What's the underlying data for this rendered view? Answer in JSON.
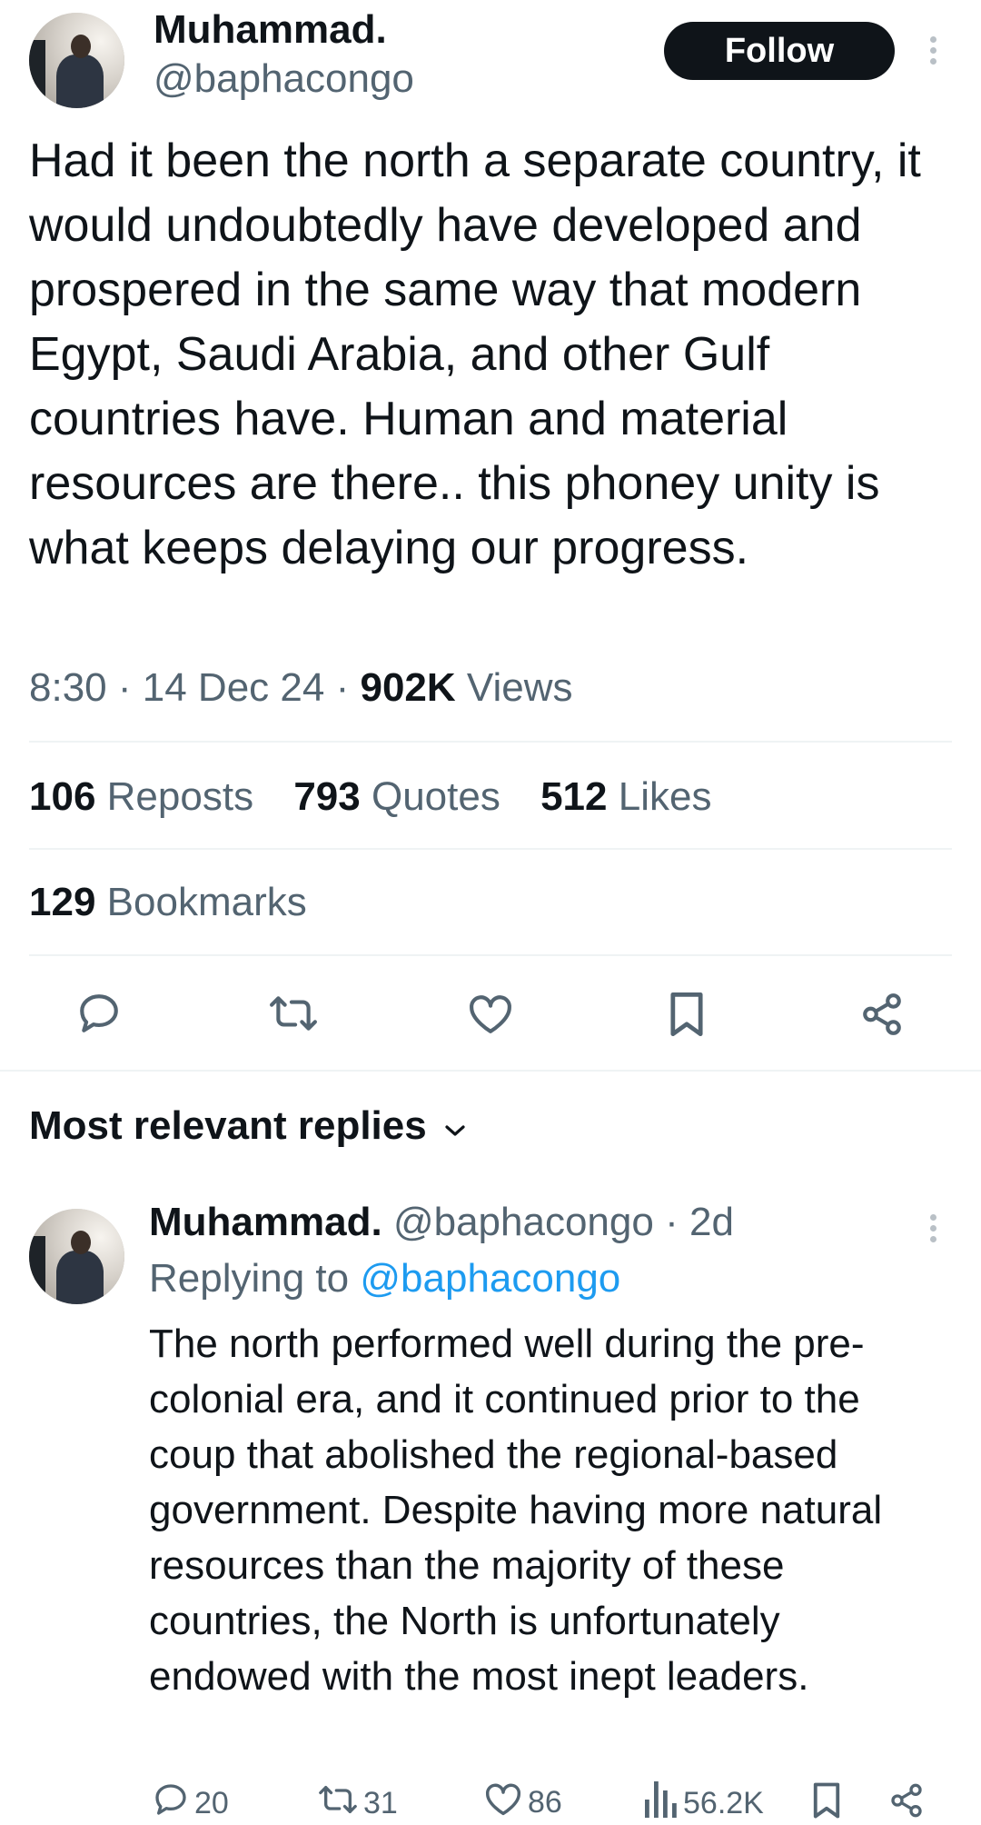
{
  "tweet": {
    "author_name": "Muhammad.",
    "author_handle": "@baphacongo",
    "follow_label": "Follow",
    "text": "Had it been the north a separate country, it would undoubtedly have developed and prospered in the same way that modern Egypt, Saudi Arabia, and other Gulf countries have. Human and material resources are there.. this phoney unity is what keeps delaying our progress.",
    "time": "8:30",
    "date": "14 Dec 24",
    "separator": "·",
    "views_count": "902K",
    "views_label": "Views"
  },
  "stats": {
    "reposts_count": "106",
    "reposts_label": "Reposts",
    "quotes_count": "793",
    "quotes_label": "Quotes",
    "likes_count": "512",
    "likes_label": "Likes",
    "bookmarks_count": "129",
    "bookmarks_label": "Bookmarks"
  },
  "actions": [
    "reply-icon",
    "repost-icon",
    "like-icon",
    "bookmark-icon",
    "share-icon"
  ],
  "replies_header": {
    "label": "Most relevant replies"
  },
  "reply": {
    "author_name": "Muhammad.",
    "author_handle": "@baphacongo",
    "separator": "·",
    "age": "2d",
    "replying_prefix": "Replying to",
    "replying_handle": "@baphacongo",
    "text": "The north performed well during the pre-colonial era, and it continued prior to the coup that abolished the regional-based government. Despite having more natural resources than the majority of these countries, the North is unfortunately endowed with the most inept leaders.",
    "reply_count": "20",
    "repost_count": "31",
    "like_count": "86",
    "views_count": "56.2K"
  },
  "colors": {
    "text_primary": "#0f1419",
    "text_secondary": "#536471",
    "link": "#1d9bf0",
    "divider": "#eff3f4",
    "button_bg": "#0f1419"
  }
}
